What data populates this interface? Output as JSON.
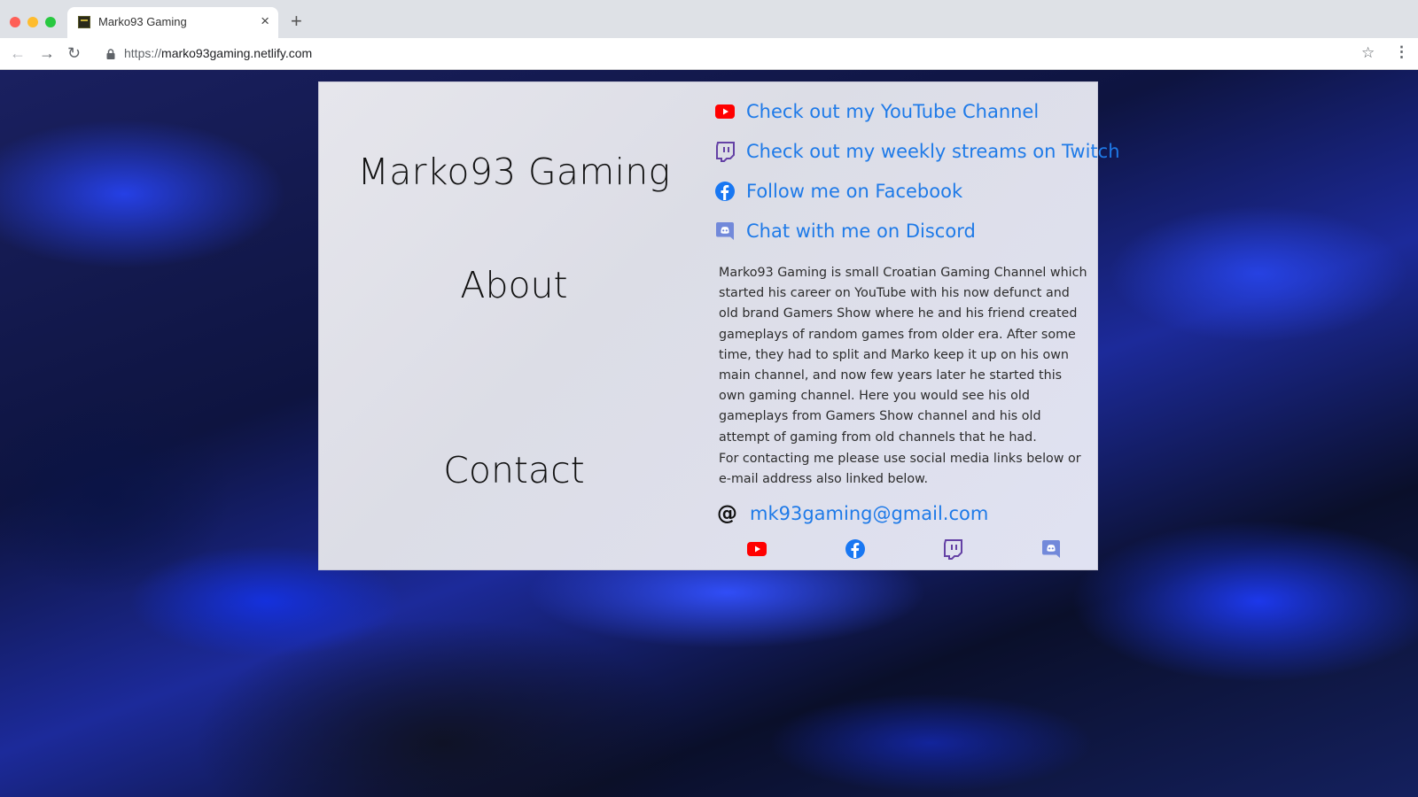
{
  "browser": {
    "tab_title": "Marko93 Gaming",
    "tab_close": "×",
    "new_tab": "+",
    "url_scheme": "https://",
    "url_host": "marko93gaming.netlify.com",
    "icons": [
      "back-arrow-icon",
      "forward-arrow-icon",
      "reload-icon",
      "lock-icon",
      "star-icon",
      "menu-icon"
    ]
  },
  "card": {
    "site_title": "Marko93 Gaming",
    "about_heading": "About",
    "contact_heading": "Contact",
    "links": [
      {
        "label": "Check out my YouTube Channel",
        "icon": "youtube-icon"
      },
      {
        "label": "Check out my weekly streams on Twitch",
        "icon": "twitch-icon"
      },
      {
        "label": "Follow me on Facebook",
        "icon": "facebook-icon"
      },
      {
        "label": "Chat with me on Discord",
        "icon": "discord-icon"
      }
    ],
    "about_text": "Marko93 Gaming is small Croatian Gaming Channel which started his career on YouTube with his now defunct and old brand Gamers Show where he and his friend created gameplays of random games from older era. After some time, they had to split and Marko keep it up on his own main channel, and now few years later he started this own gaming channel. Here you would see his old gameplays from Gamers Show channel and his old attempt of gaming from old channels that he had.",
    "contact_text": "For contacting me please use social media links below or e-mail address also linked below.",
    "email_symbol": "@",
    "email": "mk93gaming@gmail.com",
    "footer_icons": [
      "youtube-icon",
      "facebook-icon",
      "twitch-icon",
      "discord-icon"
    ]
  },
  "colors": {
    "link": "#1e7ae8",
    "youtube": "#ff0000",
    "facebook": "#1877f2",
    "twitch": "#6441a5",
    "discord": "#7289da"
  }
}
